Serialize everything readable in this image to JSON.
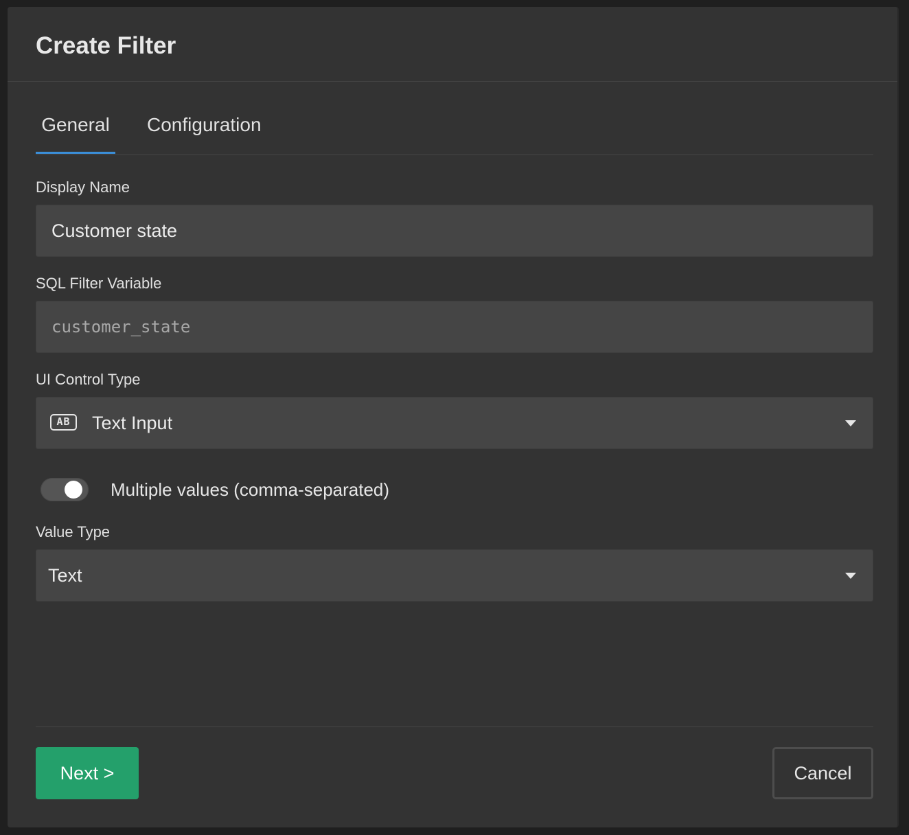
{
  "dialog": {
    "title": "Create Filter"
  },
  "tabs": [
    {
      "label": "General",
      "active": true
    },
    {
      "label": "Configuration",
      "active": false
    }
  ],
  "form": {
    "display_name": {
      "label": "Display Name",
      "value": "Customer state"
    },
    "sql_variable": {
      "label": "SQL Filter Variable",
      "value": "customer_state"
    },
    "ui_control_type": {
      "label": "UI Control Type",
      "icon": "text-input-ab-icon",
      "icon_text": "AB",
      "value": "Text Input"
    },
    "multiple_values": {
      "label": "Multiple values (comma-separated)",
      "enabled": true
    },
    "value_type": {
      "label": "Value Type",
      "value": "Text"
    }
  },
  "footer": {
    "next_label": "Next >",
    "cancel_label": "Cancel"
  },
  "colors": {
    "background": "#333333",
    "accent_tab": "#3b8fd9",
    "primary_button": "#24a06b",
    "field_bg": "#454545"
  }
}
